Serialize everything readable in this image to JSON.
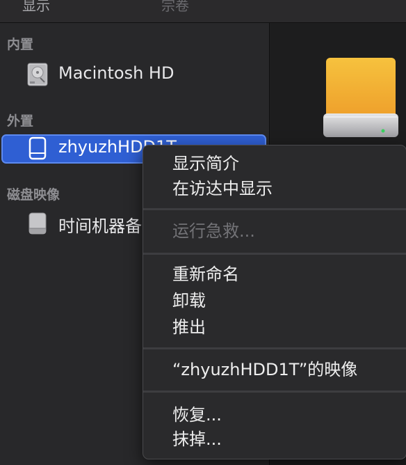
{
  "toolbar": {
    "view_label": "显示",
    "volume_label": "宗卷"
  },
  "sidebar": {
    "sections": {
      "internal": "内置",
      "external": "外置",
      "disk_images": "磁盘映像"
    },
    "items": [
      {
        "label": "Macintosh HD",
        "icon": "internal-hard-disk-icon",
        "section": "internal"
      },
      {
        "label": "zhyuzhHDD1T",
        "icon": "external-drive-icon",
        "section": "external",
        "selected": true
      },
      {
        "label": "时间机器备",
        "icon": "disk-image-icon",
        "section": "disk_images"
      }
    ]
  },
  "context_menu": {
    "groups": [
      [
        {
          "label": "显示简介",
          "enabled": true
        },
        {
          "label": "在访达中显示",
          "enabled": true
        }
      ],
      [
        {
          "label": "运行急救...",
          "enabled": false
        }
      ],
      [
        {
          "label": "重新命名",
          "enabled": true
        },
        {
          "label": "卸载",
          "enabled": true
        },
        {
          "label": "推出",
          "enabled": true
        }
      ],
      [
        {
          "label": "“zhyuzhHDD1T”的映像",
          "enabled": true
        }
      ],
      [
        {
          "label": "恢复...",
          "enabled": true
        },
        {
          "label": "抹掉...",
          "enabled": true
        }
      ]
    ]
  },
  "colors": {
    "selection": "#2f5fd3",
    "disk_orange": "#f0a830"
  }
}
